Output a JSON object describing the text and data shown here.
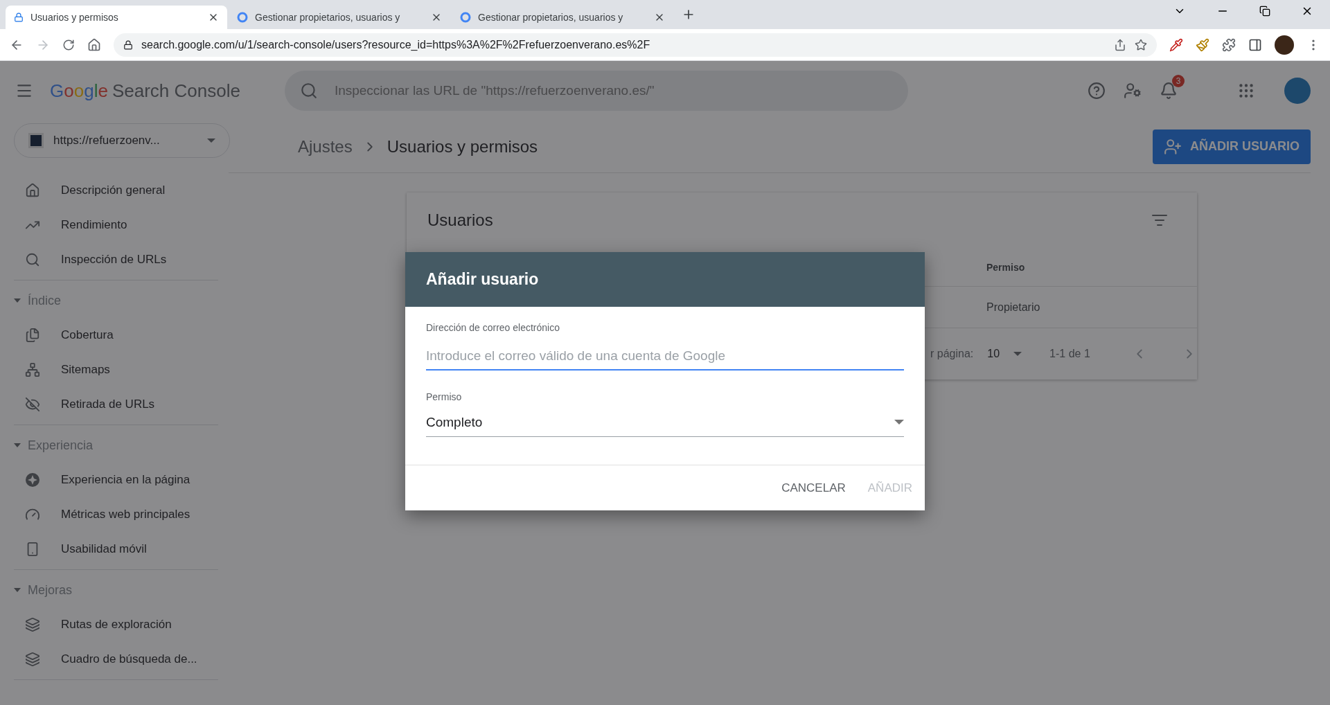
{
  "browser": {
    "tabs": [
      {
        "title": "Usuarios y permisos",
        "selected": true
      },
      {
        "title": "Gestionar propietarios, usuarios y",
        "selected": false
      },
      {
        "title": "Gestionar propietarios, usuarios y",
        "selected": false
      }
    ],
    "url": "search.google.com/u/1/search-console/users?resource_id=https%3A%2F%2Frefuerzoenverano.es%2F"
  },
  "header": {
    "logo": "Google",
    "product": "Search Console",
    "search": {
      "placeholder": "Inspeccionar las URL de \"https://refuerzoenverano.es/\""
    },
    "notifications": "3"
  },
  "property": "https://refuerzoenv...",
  "sidebar": [
    {
      "items": [
        "Descripción general",
        "Rendimiento",
        "Inspección de URLs"
      ]
    },
    {
      "heading": "Índice",
      "expanded": true,
      "items": [
        "Cobertura",
        "Sitemaps",
        "Retirada de URLs"
      ]
    },
    {
      "heading": "Experiencia",
      "expanded": true,
      "items": [
        "Experiencia en la página",
        "Métricas web principales",
        "Usabilidad móvil"
      ]
    },
    {
      "heading": "Mejoras",
      "expanded": true,
      "items": [
        "Rutas de exploración",
        "Cuadro de búsqueda de..."
      ]
    }
  ],
  "breadcrumb": [
    "Ajustes",
    "Usuarios y permisos"
  ],
  "add_user_button": "AÑADIR USUARIO",
  "card": {
    "title": "Usuarios",
    "column": "Permiso",
    "rows": [
      "Propietario"
    ],
    "rows_per_page_label": "r página:",
    "rows_per_page": "10",
    "range": "1-1 de 1"
  },
  "dialog": {
    "title": "Añadir usuario",
    "email": {
      "label": "Dirección de correo electrónico",
      "placeholder": "Introduce el correo válido de una cuenta de Google"
    },
    "permission": {
      "label": "Permiso",
      "value": "Completo"
    },
    "buttons": [
      {
        "label": "CANCELAR",
        "disabled": false
      },
      {
        "label": "AÑADIR",
        "disabled": true
      }
    ]
  }
}
